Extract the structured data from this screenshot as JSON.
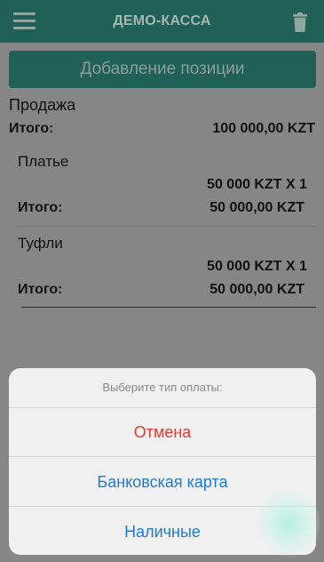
{
  "header": {
    "title": "ДЕМО-КАССА",
    "menu_icon": "hamburger-menu-icon",
    "trash_icon": "trash-icon"
  },
  "add_button": {
    "label": "Добавление позиции"
  },
  "sale": {
    "title": "Продажа",
    "total_label": "Итого:",
    "total_value": "100 000,00 KZT"
  },
  "items": [
    {
      "name": "Платье",
      "qty_line": "50 000 KZT X 1",
      "total_label": "Итого:",
      "total_value": "50 000,00 KZT"
    },
    {
      "name": "Туфли",
      "qty_line": "50 000 KZT X 1",
      "total_label": "Итого:",
      "total_value": "50 000,00 KZT"
    }
  ],
  "payment_sheet": {
    "title": "Выберите тип оплаты:",
    "options": [
      {
        "label": "Отмена",
        "color": "#e53b30"
      },
      {
        "label": "Банковская карта",
        "color": "#1f7ad1"
      },
      {
        "label": "Наличные",
        "color": "#1f7ad1"
      }
    ]
  },
  "colors": {
    "header_bg_dimmed": "#1f6157",
    "overlay_bg": "#868686",
    "cancel": "#e53b30",
    "action": "#1f7ad1"
  }
}
